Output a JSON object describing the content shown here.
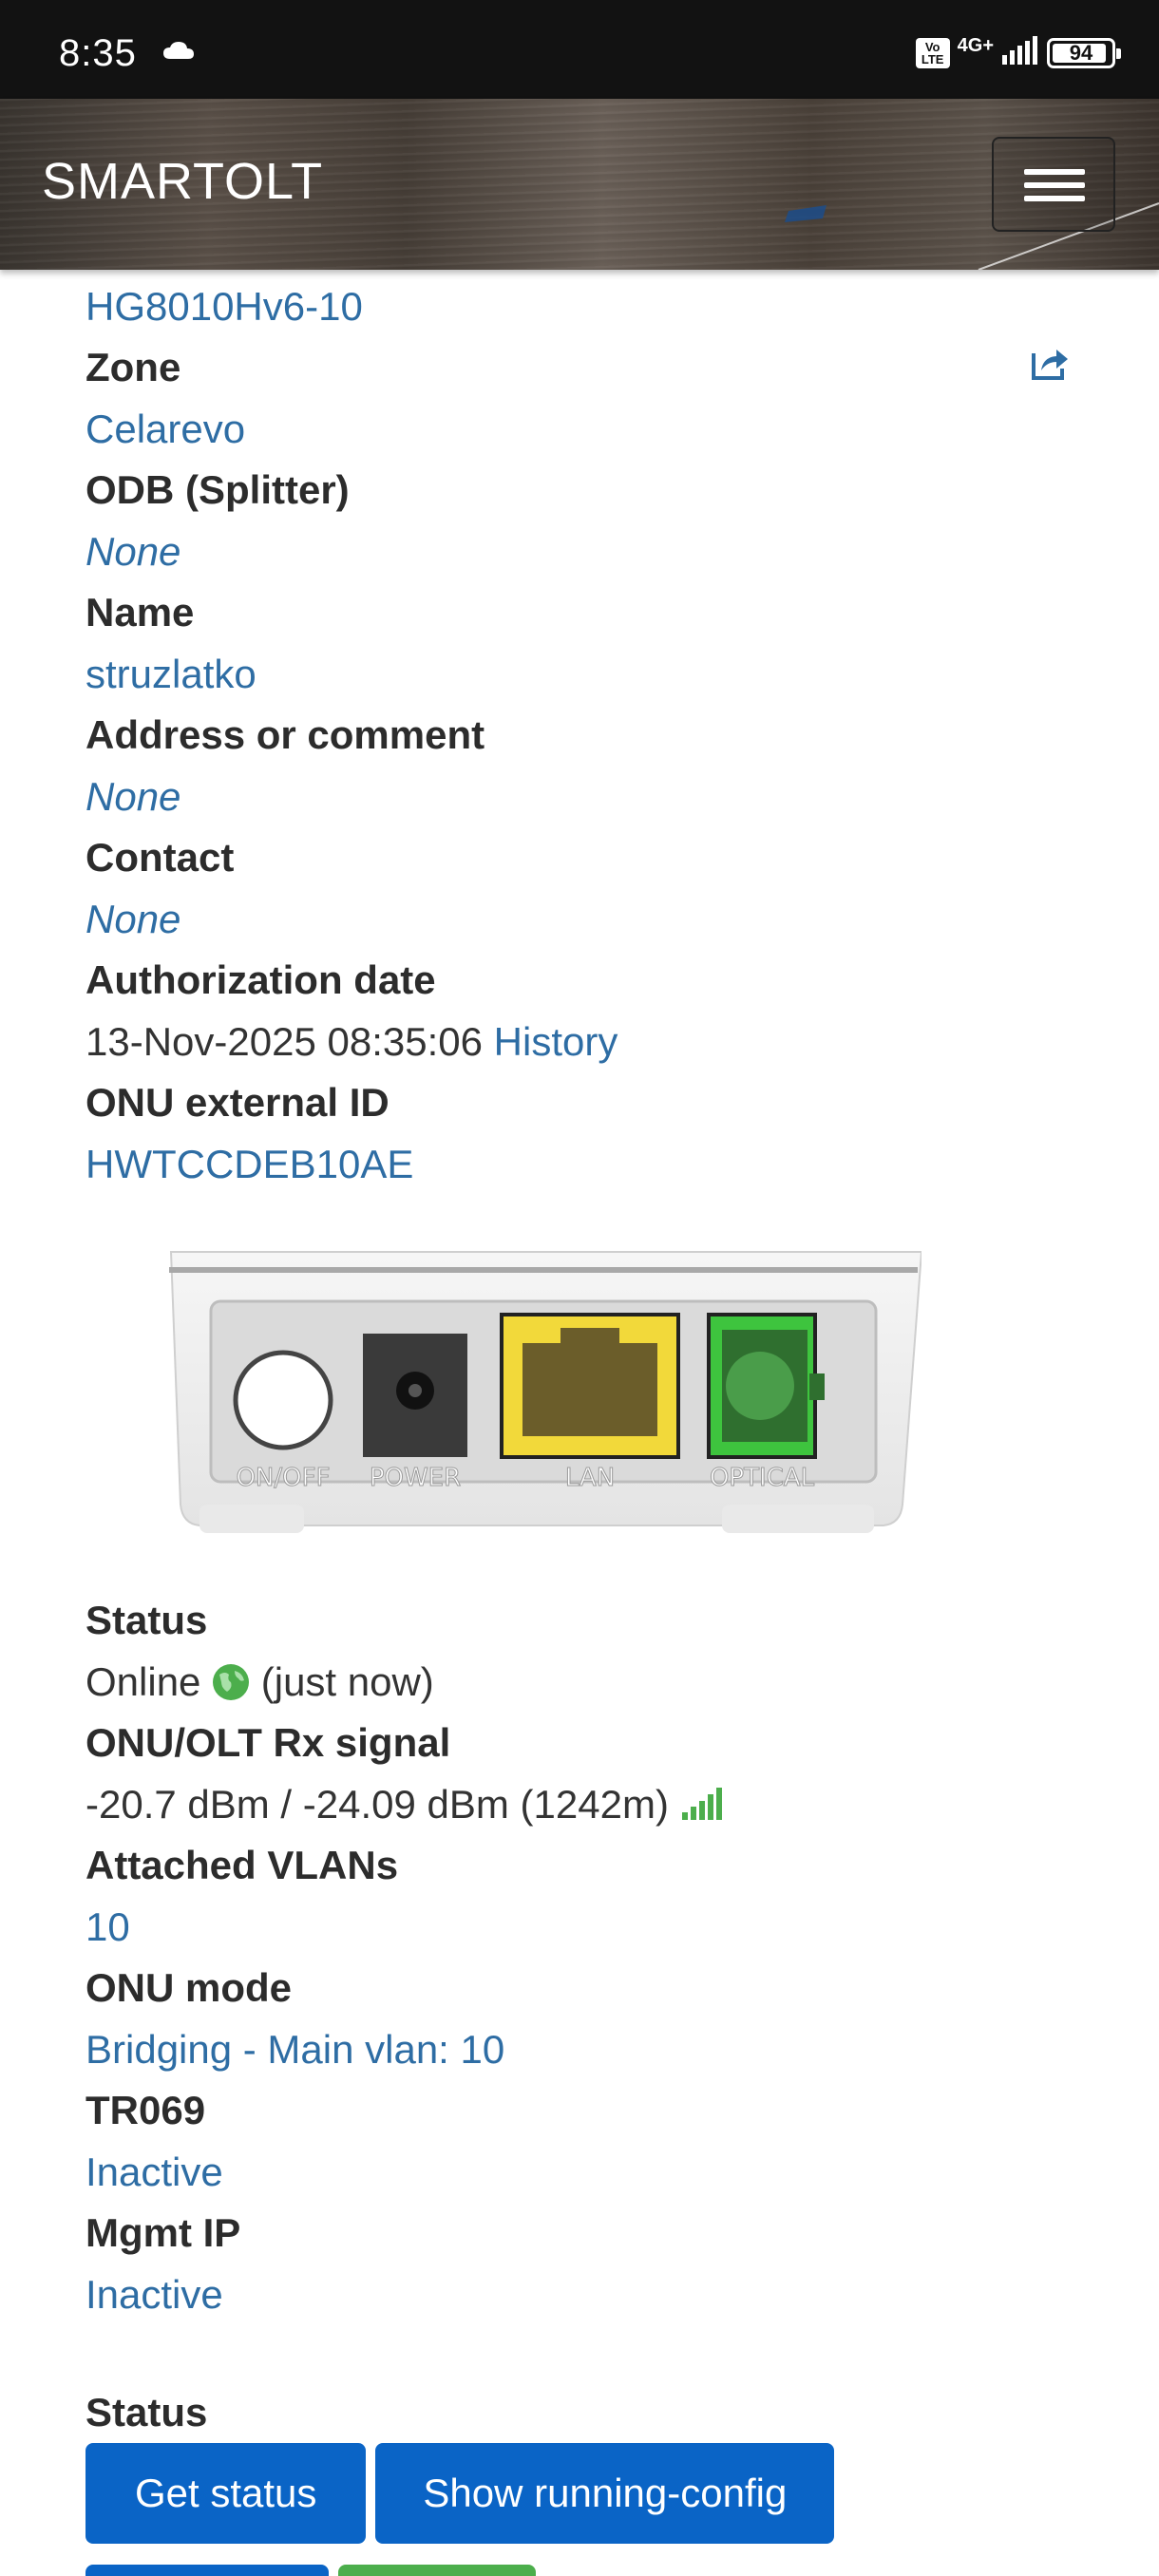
{
  "statusbar": {
    "time": "8:35",
    "volte_line1": "Vo",
    "volte_line2": "LTE",
    "network": "4G+",
    "battery": "94",
    "battery_level": 0.94
  },
  "navbar": {
    "brand": "SMARTOLT",
    "menu_icon": "hamburger-icon"
  },
  "details": {
    "onu_type": "HG8010Hv6-10",
    "zone_label": "Zone",
    "zone": "Celarevo",
    "odb_label": "ODB (Splitter)",
    "odb": "None",
    "name_label": "Name",
    "name": "struzlatko",
    "address_label": "Address or comment",
    "address": "None",
    "contact_label": "Contact",
    "contact": "None",
    "auth_label": "Authorization date",
    "auth_date": "13-Nov-2025 08:35:06",
    "history_link": "History",
    "ext_id_label": "ONU external ID",
    "ext_id": "HWTCCDEB10AE"
  },
  "device_image": {
    "port_labels": [
      "ON/OFF",
      "POWER",
      "LAN",
      "OPTICAL"
    ]
  },
  "status": {
    "status_label": "Status",
    "status_value": "Online",
    "status_time": "(just now)",
    "signal_label": "ONU/OLT Rx signal",
    "signal_value": "-20.7 dBm / -24.09 dBm (1242m)",
    "vlans_label": "Attached VLANs",
    "vlans": "10",
    "mode_label": "ONU mode",
    "mode": "Bridging - Main vlan: 10",
    "tr069_label": "TR069",
    "tr069": "Inactive",
    "mgmt_label": "Mgmt IP",
    "mgmt": "Inactive"
  },
  "actions": {
    "section_label": "Status",
    "get_status": "Get status",
    "show_config": "Show running-config"
  },
  "colors": {
    "link": "#2e6da4",
    "button": "#0a64c6",
    "online_green": "#4cae4c"
  }
}
